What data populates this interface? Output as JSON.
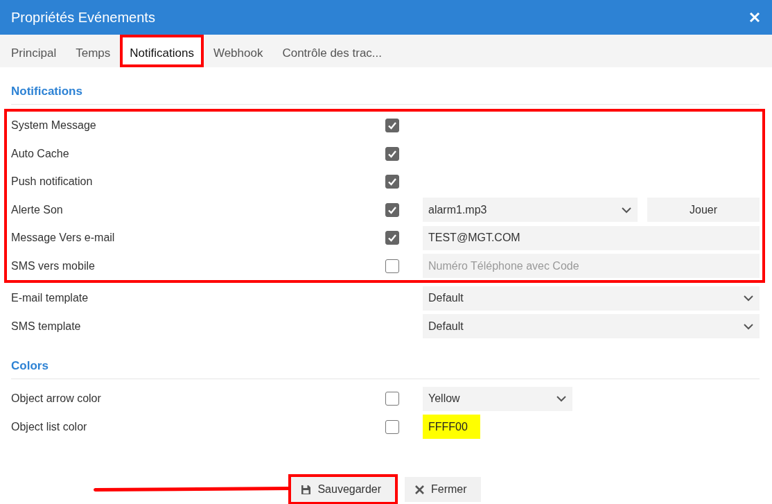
{
  "window": {
    "title": "Propriétés Evénements"
  },
  "tabs": [
    {
      "label": "Principal",
      "selected": false,
      "highlighted": false
    },
    {
      "label": "Temps",
      "selected": false,
      "highlighted": false
    },
    {
      "label": "Notifications",
      "selected": true,
      "highlighted": true
    },
    {
      "label": "Webhook",
      "selected": false,
      "highlighted": false
    },
    {
      "label": "Contrôle des trac...",
      "selected": false,
      "highlighted": false
    }
  ],
  "sections": [
    {
      "title": "Notifications",
      "groups": [
        {
          "highlighted": true,
          "rows": [
            {
              "kind": "check",
              "label": "System Message",
              "checked": true
            },
            {
              "kind": "check",
              "label": "Auto Cache",
              "checked": true
            },
            {
              "kind": "check",
              "label": "Push notification",
              "checked": true
            },
            {
              "kind": "select-button",
              "label": "Alerte Son",
              "checked": true,
              "value": "alarm1.mp3",
              "button": "Jouer"
            },
            {
              "kind": "input",
              "label": "Message Vers e-mail",
              "checked": true,
              "value": "TEST@MGT.COM"
            },
            {
              "kind": "input",
              "label": "SMS vers mobile",
              "checked": false,
              "placeholder": "Numéro Téléphone avec Code"
            }
          ]
        },
        {
          "highlighted": false,
          "rows": [
            {
              "kind": "select",
              "label": "E-mail template",
              "value": "Default"
            },
            {
              "kind": "select",
              "label": "SMS template",
              "value": "Default"
            }
          ]
        }
      ]
    },
    {
      "title": "Colors",
      "groups": [
        {
          "highlighted": false,
          "rows": [
            {
              "kind": "short-select",
              "label": "Object arrow color",
              "checked": false,
              "value": "Yellow"
            },
            {
              "kind": "color",
              "label": "Object list color",
              "checked": false,
              "value": "FFFF00",
              "color": "#ffff00"
            }
          ]
        }
      ]
    }
  ],
  "buttons": [
    {
      "kind": "save",
      "label": "Sauvegarder",
      "highlighted": true,
      "pointed": true
    },
    {
      "kind": "close",
      "label": "Fermer",
      "highlighted": false,
      "pointed": false
    }
  ]
}
